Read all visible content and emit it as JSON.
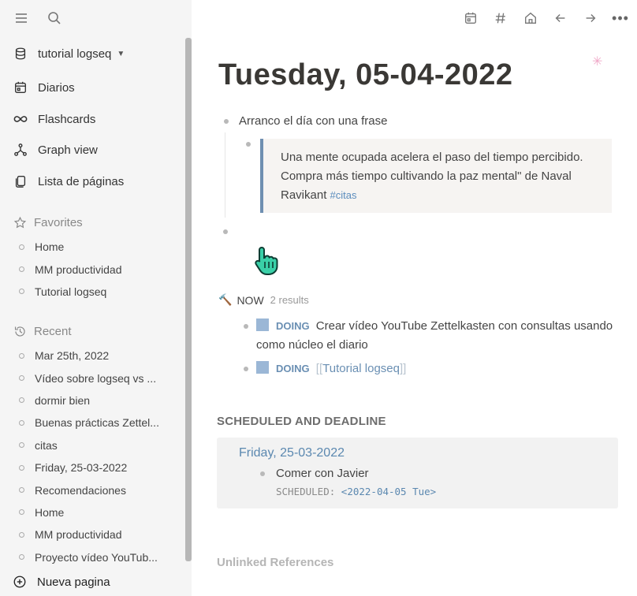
{
  "sidebar": {
    "graph_name": "tutorial logseq",
    "nav": [
      {
        "label": "Diarios",
        "icon": "calendar-icon"
      },
      {
        "label": "Flashcards",
        "icon": "infinity-icon"
      },
      {
        "label": "Graph view",
        "icon": "graph-icon"
      },
      {
        "label": "Lista de páginas",
        "icon": "pages-icon"
      }
    ],
    "favorites_title": "Favorites",
    "favorites": [
      "Home",
      "MM productividad",
      "Tutorial logseq"
    ],
    "recent_title": "Recent",
    "recent": [
      "Mar 25th, 2022",
      "Vídeo sobre logseq vs ...",
      "dormir bien",
      "Buenas prácticas Zettel...",
      "citas",
      "Friday, 25-03-2022",
      "Recomendaciones",
      "Home",
      "MM productividad",
      "Proyecto vídeo YouTub..."
    ],
    "new_page": "Nueva pagina"
  },
  "main": {
    "title": "Tuesday, 05-04-2022",
    "block1": "Arranco el día con una frase",
    "quote_text": "Una mente ocupada acelera el paso del tiempo percibido. Compra más tiempo cultivando la paz mental\" de Naval Ravikant ",
    "quote_tag": "#citas",
    "now": {
      "title": "NOW",
      "count": "2 results",
      "tasks": [
        {
          "marker": "DOING",
          "text": "Crear vídeo YouTube Zettelkasten con consultas usando como núcleo el diario"
        },
        {
          "marker": "DOING",
          "open": "[[",
          "ref": "Tutorial logseq",
          "close": "]]"
        }
      ]
    },
    "scheduled": {
      "title": "SCHEDULED AND DEADLINE",
      "date": "Friday, 25-03-2022",
      "item": "Comer con Javier",
      "meta_label": "SCHEDULED:",
      "meta_value": "<2022-04-05 Tue>"
    },
    "unlinked": "Unlinked References"
  },
  "colors": {
    "accent": "#6a8fb3",
    "sidebar_bg": "#f5f5f5",
    "quote_border": "#6f8fb1",
    "checkbox": "#9bb7d6"
  }
}
